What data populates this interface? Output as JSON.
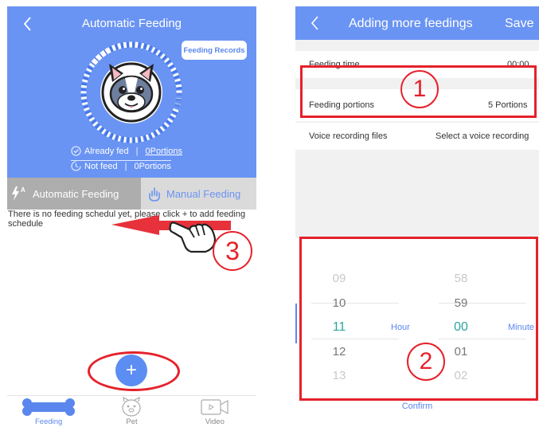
{
  "left_screen": {
    "title": "Automatic Feeding",
    "feeding_records_button": "Feeding Records",
    "status": {
      "fed_label": "Already fed",
      "fed_value": "0Portions",
      "not_fed_label": "Not feed",
      "not_fed_value": "0Portions"
    },
    "tabs": {
      "automatic": "Automatic Feeding",
      "manual": "Manual Feeding"
    },
    "empty_message": "There is no feeding schedul yet, please click + to add feeding schedule",
    "add_button": "+",
    "nav": {
      "feeding": "Feeding",
      "pet": "Pet",
      "video": "Video"
    }
  },
  "right_screen": {
    "title": "Adding more feedings",
    "save_label": "Save",
    "rows": {
      "feeding_time_label": "Feeding time",
      "feeding_time_value": "00:00",
      "portions_label": "Feeding portions",
      "portions_value": "5  Portions",
      "voice_label": "Voice recording files",
      "voice_value": "Select a voice recording"
    },
    "picker": {
      "hours": [
        "09",
        "10",
        "11",
        "12",
        "13"
      ],
      "hour_unit": "Hour",
      "minutes": [
        "58",
        "59",
        "00",
        "01",
        "02"
      ],
      "minute_unit": "Minute"
    },
    "confirm_label": "Confirm"
  },
  "annotations": {
    "one": "1",
    "two": "2",
    "three": "3"
  },
  "colors": {
    "header_blue": "#6a94f3",
    "annotation_red": "#e5212b",
    "selected_teal": "#2aa6a0"
  },
  "icons": {
    "back": "chevron-left-icon",
    "dog": "bulldog-face-icon",
    "check": "check-circle-icon",
    "clock": "clock-icon",
    "auto_mode": "auto-flash-icon",
    "manual_mode": "hand-tap-icon",
    "feeding_nav": "bone-icon",
    "pet_nav": "pet-face-icon",
    "video_nav": "video-camera-icon",
    "pointer": "pointing-hand-icon"
  }
}
